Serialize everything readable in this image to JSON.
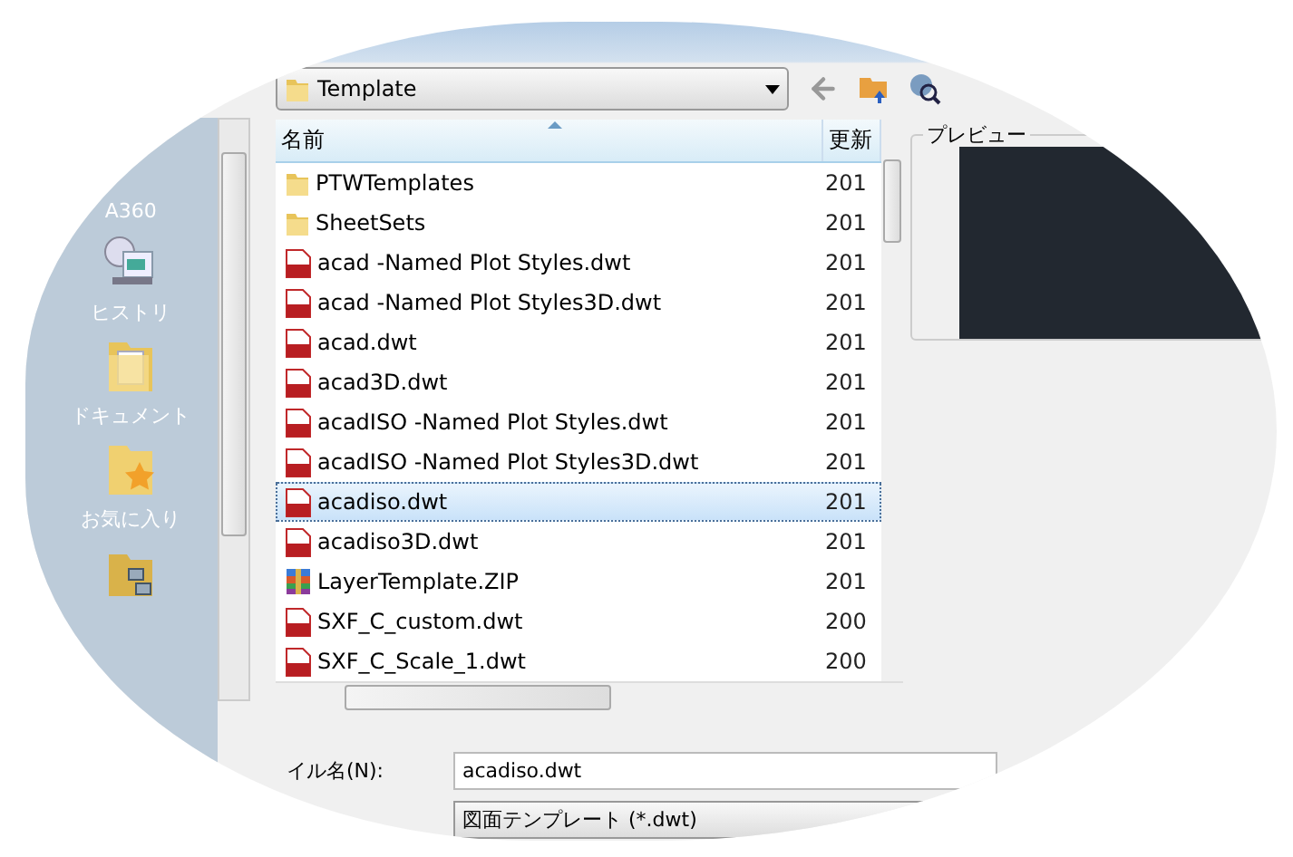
{
  "location": {
    "folder": "Template"
  },
  "places": [
    {
      "kind": "text",
      "label": "A360"
    },
    {
      "kind": "history",
      "label": "ヒストリ"
    },
    {
      "kind": "documents",
      "label": "ドキュメント"
    },
    {
      "kind": "favorites",
      "label": "お気に入り"
    },
    {
      "kind": "network"
    }
  ],
  "columns": [
    {
      "label": "名前",
      "sorted": true
    },
    {
      "label": "更新",
      "sorted": false
    }
  ],
  "files": [
    {
      "name": "PTWTemplates",
      "kind": "folder",
      "date": "201",
      "selected": false
    },
    {
      "name": "SheetSets",
      "kind": "folder",
      "date": "201",
      "selected": false
    },
    {
      "name": "acad -Named Plot Styles.dwt",
      "kind": "dwt",
      "date": "201",
      "selected": false
    },
    {
      "name": "acad -Named Plot Styles3D.dwt",
      "kind": "dwt",
      "date": "201",
      "selected": false
    },
    {
      "name": "acad.dwt",
      "kind": "dwt",
      "date": "201",
      "selected": false
    },
    {
      "name": "acad3D.dwt",
      "kind": "dwt",
      "date": "201",
      "selected": false
    },
    {
      "name": "acadISO -Named Plot Styles.dwt",
      "kind": "dwt",
      "date": "201",
      "selected": false
    },
    {
      "name": "acadISO -Named Plot Styles3D.dwt",
      "kind": "dwt",
      "date": "201",
      "selected": false
    },
    {
      "name": "acadiso.dwt",
      "kind": "dwt",
      "date": "201",
      "selected": true
    },
    {
      "name": "acadiso3D.dwt",
      "kind": "dwt",
      "date": "201",
      "selected": false
    },
    {
      "name": "LayerTemplate.ZIP",
      "kind": "zip",
      "date": "201",
      "selected": false
    },
    {
      "name": "SXF_C_custom.dwt",
      "kind": "dwt",
      "date": "200",
      "selected": false
    },
    {
      "name": "SXF_C_Scale_1.dwt",
      "kind": "dwt",
      "date": "200",
      "selected": false
    }
  ],
  "preview": {
    "label": "プレビュー"
  },
  "filename": {
    "label": "イル名(N):",
    "value": "acadiso.dwt"
  },
  "filetype": {
    "value": "図面テンプレート (*.dwt)"
  }
}
